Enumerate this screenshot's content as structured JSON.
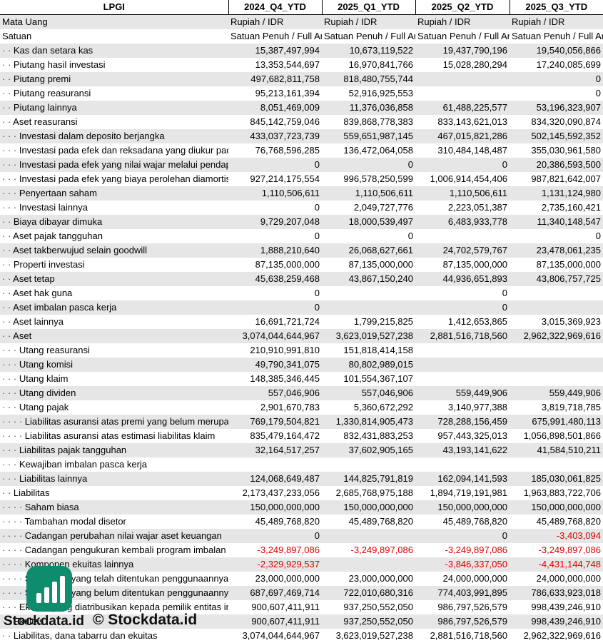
{
  "header": {
    "label": "LPGI",
    "cols": [
      "2024_Q4_YTD",
      "2025_Q1_YTD",
      "2025_Q2_YTD",
      "2025_Q3_YTD"
    ]
  },
  "rows": [
    {
      "label": "Mata Uang",
      "dots": "",
      "vals": [
        "Rupiah / IDR",
        "Rupiah / IDR",
        "Rupiah / IDR",
        "Rupiah / IDR"
      ],
      "text": true
    },
    {
      "label": "Satuan",
      "dots": "",
      "vals": [
        "Satuan Penuh / Full Amount",
        "Satuan Penuh / Full Amount",
        "Satuan Penuh / Full Amount",
        "Satuan Penuh / Full Amount"
      ],
      "text": true
    },
    {
      "label": "Kas dan setara kas",
      "dots": "· · ",
      "vals": [
        "15,387,497,994",
        "10,673,119,522",
        "19,437,790,196",
        "19,540,056,866"
      ]
    },
    {
      "label": "Piutang hasil investasi",
      "dots": "· · ",
      "vals": [
        "13,353,544,697",
        "16,970,841,766",
        "15,028,280,294",
        "17,240,085,699"
      ]
    },
    {
      "label": "Piutang premi",
      "dots": "· · ",
      "vals": [
        "497,682,811,758",
        "818,480,755,744",
        "",
        "0"
      ]
    },
    {
      "label": "Piutang reasuransi",
      "dots": "· · ",
      "vals": [
        "95,213,161,394",
        "52,916,925,553",
        "",
        "0"
      ]
    },
    {
      "label": "Piutang lainnya",
      "dots": "· · ",
      "vals": [
        "8,051,469,009",
        "11,376,036,858",
        "61,488,225,577",
        "53,196,323,907"
      ]
    },
    {
      "label": "Aset reasuransi",
      "dots": "· · ",
      "vals": [
        "845,142,759,046",
        "839,868,778,383",
        "833,143,621,013",
        "834,320,090,874"
      ]
    },
    {
      "label": "Investasi dalam deposito berjangka",
      "dots": "· · · ",
      "vals": [
        "433,037,723,739",
        "559,651,987,145",
        "467,015,821,286",
        "502,145,592,352"
      ]
    },
    {
      "label": "Investasi pada efek dan reksadana yang diukur pada nilai wajar",
      "dots": "· · · ",
      "vals": [
        "76,768,596,285",
        "136,472,064,058",
        "310,484,148,487",
        "355,030,961,580"
      ]
    },
    {
      "label": "Investasi pada efek yang nilai wajar melalui pendapatan komprehensif lain",
      "dots": "· · · ",
      "vals": [
        "0",
        "0",
        "0",
        "20,386,593,500"
      ]
    },
    {
      "label": "Investasi pada efek yang biaya perolehan diamortisasi",
      "dots": "· · · ",
      "vals": [
        "927,214,175,554",
        "996,578,250,599",
        "1,006,914,454,406",
        "987,821,642,007"
      ]
    },
    {
      "label": "Penyertaan saham",
      "dots": "· · · ",
      "vals": [
        "1,110,506,611",
        "1,110,506,611",
        "1,110,506,611",
        "1,131,124,980"
      ]
    },
    {
      "label": "Investasi lainnya",
      "dots": "· · · ",
      "vals": [
        "0",
        "2,049,727,776",
        "2,223,051,387",
        "2,735,160,421"
      ]
    },
    {
      "label": "Biaya dibayar dimuka",
      "dots": "· · ",
      "vals": [
        "9,729,207,048",
        "18,000,539,497",
        "6,483,933,778",
        "11,340,148,547"
      ]
    },
    {
      "label": "Aset pajak tangguhan",
      "dots": "· · ",
      "vals": [
        "0",
        "0",
        "",
        "0"
      ]
    },
    {
      "label": "Aset takberwujud selain goodwill",
      "dots": "· · ",
      "vals": [
        "1,888,210,640",
        "26,068,627,661",
        "24,702,579,767",
        "23,478,061,235"
      ]
    },
    {
      "label": "Properti investasi",
      "dots": "· · ",
      "vals": [
        "87,135,000,000",
        "87,135,000,000",
        "87,135,000,000",
        "87,135,000,000"
      ]
    },
    {
      "label": "Aset tetap",
      "dots": "· · ",
      "vals": [
        "45,638,259,468",
        "43,867,150,240",
        "44,936,651,893",
        "43,806,757,725"
      ]
    },
    {
      "label": "Aset hak guna",
      "dots": "· · ",
      "vals": [
        "0",
        "",
        "0",
        ""
      ]
    },
    {
      "label": "Aset imbalan pasca kerja",
      "dots": "· · ",
      "vals": [
        "0",
        "",
        "0",
        ""
      ]
    },
    {
      "label": "Aset lainnya",
      "dots": "· · ",
      "vals": [
        "16,691,721,724",
        "1,799,215,825",
        "1,412,653,865",
        "3,015,369,923"
      ]
    },
    {
      "label": "Aset",
      "dots": "· · ",
      "vals": [
        "3,074,044,644,967",
        "3,623,019,527,238",
        "2,881,516,718,560",
        "2,962,322,969,616"
      ]
    },
    {
      "label": "Utang reasuransi",
      "dots": "· · · ",
      "vals": [
        "210,910,991,810",
        "151,818,414,158",
        "",
        ""
      ]
    },
    {
      "label": "Utang komisi",
      "dots": "· · · ",
      "vals": [
        "49,790,341,075",
        "80,802,989,015",
        "",
        ""
      ]
    },
    {
      "label": "Utang klaim",
      "dots": "· · · ",
      "vals": [
        "148,385,346,445",
        "101,554,367,107",
        "",
        ""
      ]
    },
    {
      "label": "Utang dividen",
      "dots": "· · · ",
      "vals": [
        "557,046,906",
        "557,046,906",
        "559,449,906",
        "559,449,906"
      ]
    },
    {
      "label": "Utang pajak",
      "dots": "· · · ",
      "vals": [
        "2,901,670,783",
        "5,360,672,292",
        "3,140,977,388",
        "3,819,718,785"
      ]
    },
    {
      "label": "Liabilitas asuransi atas premi yang belum merupakan pendapatan",
      "dots": "· · · · ",
      "vals": [
        "769,179,504,821",
        "1,330,814,905,473",
        "728,288,156,459",
        "675,991,480,113"
      ]
    },
    {
      "label": "Liabilitas asuransi atas estimasi liabilitas klaim",
      "dots": "· · · · ",
      "vals": [
        "835,479,164,472",
        "832,431,883,253",
        "957,443,325,013",
        "1,056,898,501,866"
      ]
    },
    {
      "label": "Liabilitas pajak tangguhan",
      "dots": "· · · ",
      "vals": [
        "32,164,517,257",
        "37,602,905,165",
        "43,193,141,622",
        "41,584,510,211"
      ]
    },
    {
      "label": "Kewajiban imbalan pasca kerja",
      "dots": "· · · ",
      "vals": [
        "",
        "",
        "",
        ""
      ]
    },
    {
      "label": "Liabilitas lainnya",
      "dots": "· · · ",
      "vals": [
        "124,068,649,487",
        "144,825,791,819",
        "162,094,141,593",
        "185,030,061,825"
      ]
    },
    {
      "label": "Liabilitas",
      "dots": "· · ",
      "vals": [
        "2,173,437,233,056",
        "2,685,768,975,188",
        "1,894,719,191,981",
        "1,963,883,722,706"
      ]
    },
    {
      "label": "Saham biasa",
      "dots": "· · · · ",
      "vals": [
        "150,000,000,000",
        "150,000,000,000",
        "150,000,000,000",
        "150,000,000,000"
      ]
    },
    {
      "label": "Tambahan modal disetor",
      "dots": "· · · · ",
      "vals": [
        "45,489,768,820",
        "45,489,768,820",
        "45,489,768,820",
        "45,489,768,820"
      ]
    },
    {
      "label": "Cadangan perubahan nilai wajar aset keuangan",
      "dots": "· · · · ",
      "vals": [
        "0",
        "",
        "0",
        "-3,403,094"
      ]
    },
    {
      "label": "Cadangan pengukuran kembali program imbalan pasti",
      "dots": "· · · · ",
      "vals": [
        "-3,249,897,086",
        "-3,249,897,086",
        "-3,249,897,086",
        "-3,249,897,086"
      ]
    },
    {
      "label": "Komponen ekuitas lainnya",
      "dots": "· · · · ",
      "vals": [
        "-2,329,929,537",
        "",
        "-3,846,337,050",
        "-4,431,144,748"
      ]
    },
    {
      "label": "Saldo laba yang telah ditentukan penggunaannya",
      "dots": "· · · · ",
      "vals": [
        "23,000,000,000",
        "23,000,000,000",
        "24,000,000,000",
        "24,000,000,000"
      ]
    },
    {
      "label": "Saldo laba yang belum ditentukan penggunaannya",
      "dots": "· · · · ",
      "vals": [
        "687,697,469,714",
        "722,010,680,316",
        "774,403,991,895",
        "786,633,923,018"
      ]
    },
    {
      "label": "Ekuitas yang diatribusikan kepada pemilik entitas induk",
      "dots": "· · · ",
      "vals": [
        "900,607,411,911",
        "937,250,552,050",
        "986,797,526,579",
        "998,439,246,910"
      ]
    },
    {
      "label": "Ekuitas",
      "dots": "· · ",
      "vals": [
        "900,607,411,911",
        "937,250,552,050",
        "986,797,526,579",
        "998,439,246,910"
      ]
    },
    {
      "label": "Liabilitas, dana tabarru dan ekuitas",
      "dots": "· · ",
      "vals": [
        "3,074,044,644,967",
        "3,623,019,527,238",
        "2,881,516,718,560",
        "2,962,322,969,616"
      ]
    }
  ],
  "watermark": {
    "copyright": "© Stockdata.id",
    "brand": "Stockdata.id"
  }
}
